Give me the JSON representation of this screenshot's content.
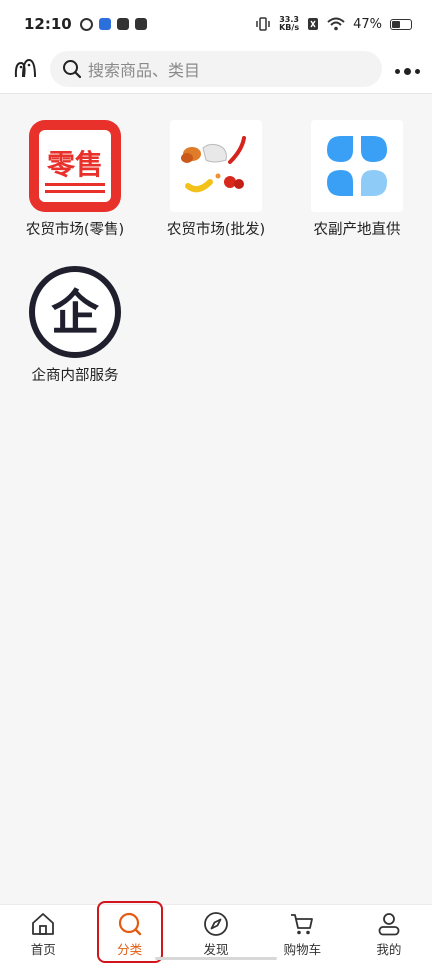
{
  "status_bar": {
    "time": "12:10",
    "net_speed_value": "33.3",
    "net_speed_unit": "KB/s",
    "battery_percent": "47%",
    "battery_level": 0.47
  },
  "search": {
    "placeholder": "搜索商品、类目",
    "scan_icon": "scan-icon",
    "more_icon": "more-dots-icon"
  },
  "categories": [
    {
      "label": "农贸市场(零售)",
      "icon_text": "零售",
      "icon": "retail-icon"
    },
    {
      "label": "农贸市场(批发)",
      "icon": "produce-icon"
    },
    {
      "label": "农副产地直供",
      "icon": "blue-petals-icon"
    },
    {
      "label": "企商内部服务",
      "icon_text": "企",
      "icon": "enterprise-icon"
    }
  ],
  "tabbar": {
    "items": [
      {
        "label": "首页",
        "icon": "home-icon",
        "active": false
      },
      {
        "label": "分类",
        "icon": "search-icon",
        "active": true
      },
      {
        "label": "发现",
        "icon": "compass-icon",
        "active": false
      },
      {
        "label": "购物车",
        "icon": "cart-icon",
        "active": false
      },
      {
        "label": "我的",
        "icon": "user-icon",
        "active": false
      }
    ]
  },
  "colors": {
    "accent": "#e35b12",
    "retail_red": "#e8312b",
    "highlight_red": "#d2141c",
    "petal_blue": "#3aa0f5",
    "enterprise_dark": "#1f1f2e"
  }
}
